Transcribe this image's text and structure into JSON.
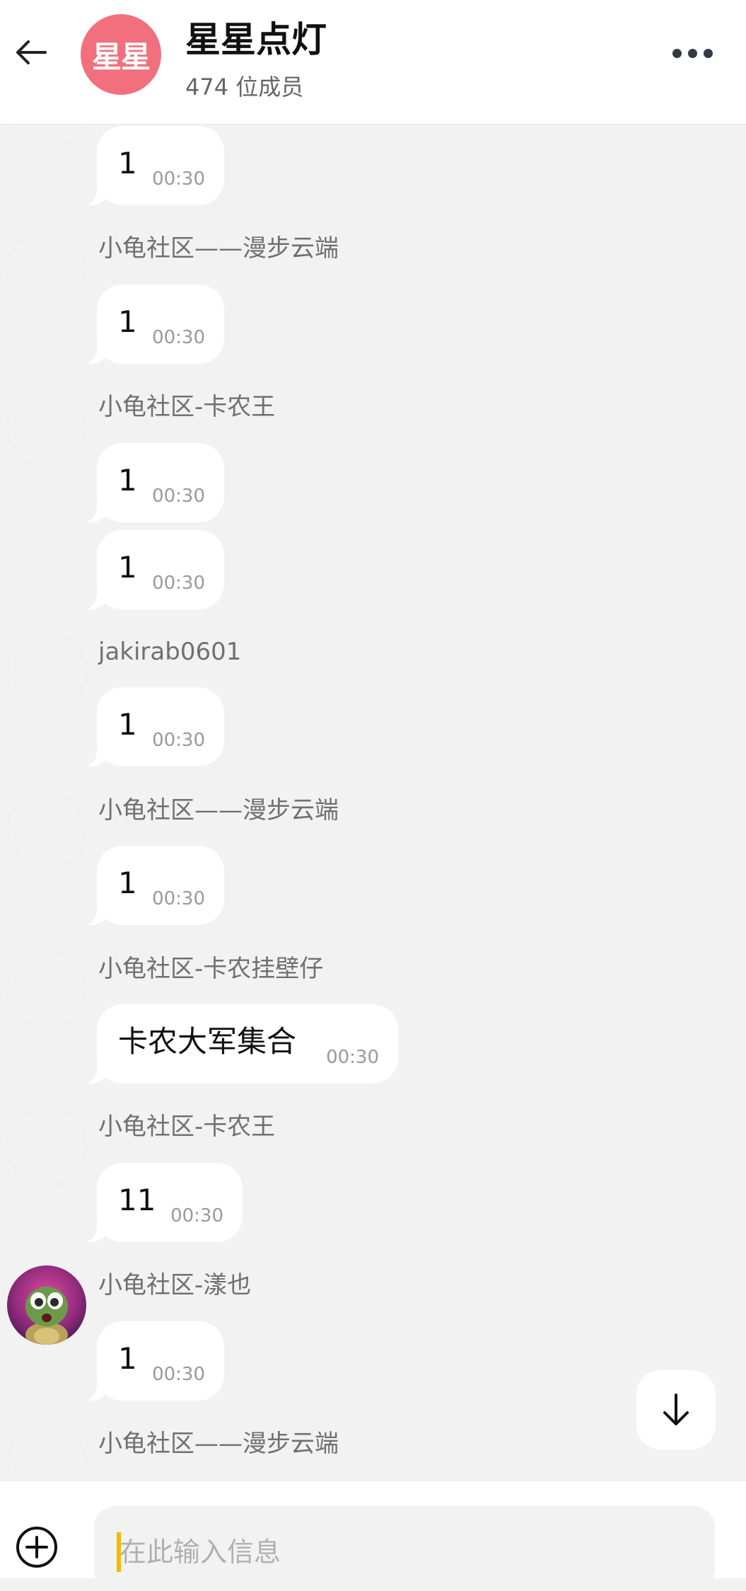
{
  "header": {
    "title": "星星点灯",
    "member_count": "474 位成员",
    "avatar_text": "星星",
    "avatar_color": "#f2707e"
  },
  "messages": [
    {
      "sender": "",
      "text": "1",
      "time": "00:30"
    },
    {
      "sender": "小龟社区——漫步云端",
      "text": "1",
      "time": "00:30"
    },
    {
      "sender": "小龟社区-卡农王",
      "text": "1",
      "time": "00:30"
    },
    {
      "sender": "",
      "text": "1",
      "time": "00:30"
    },
    {
      "sender": "jakirab0601",
      "text": "1",
      "time": "00:30"
    },
    {
      "sender": "小龟社区——漫步云端",
      "text": "1",
      "time": "00:30"
    },
    {
      "sender": "小龟社区-卡农挂壁仔",
      "text": "卡农大军集合",
      "time": "00:30"
    },
    {
      "sender": "小龟社区-卡农王",
      "text": "11",
      "time": "00:30"
    },
    {
      "sender": "小龟社区-漾也",
      "text": "1",
      "time": "00:30"
    },
    {
      "sender": "小龟社区——漫步云端",
      "text": "",
      "time": ""
    }
  ],
  "input": {
    "placeholder": "在此输入信息"
  },
  "icons": {
    "back": "arrow-left-icon",
    "more": "more-dots-icon",
    "scroll_down": "arrow-down-icon",
    "add": "plus-circle-icon"
  },
  "colors": {
    "background": "#f2f2f2",
    "bubble": "#ffffff",
    "caret": "#f5b800"
  }
}
